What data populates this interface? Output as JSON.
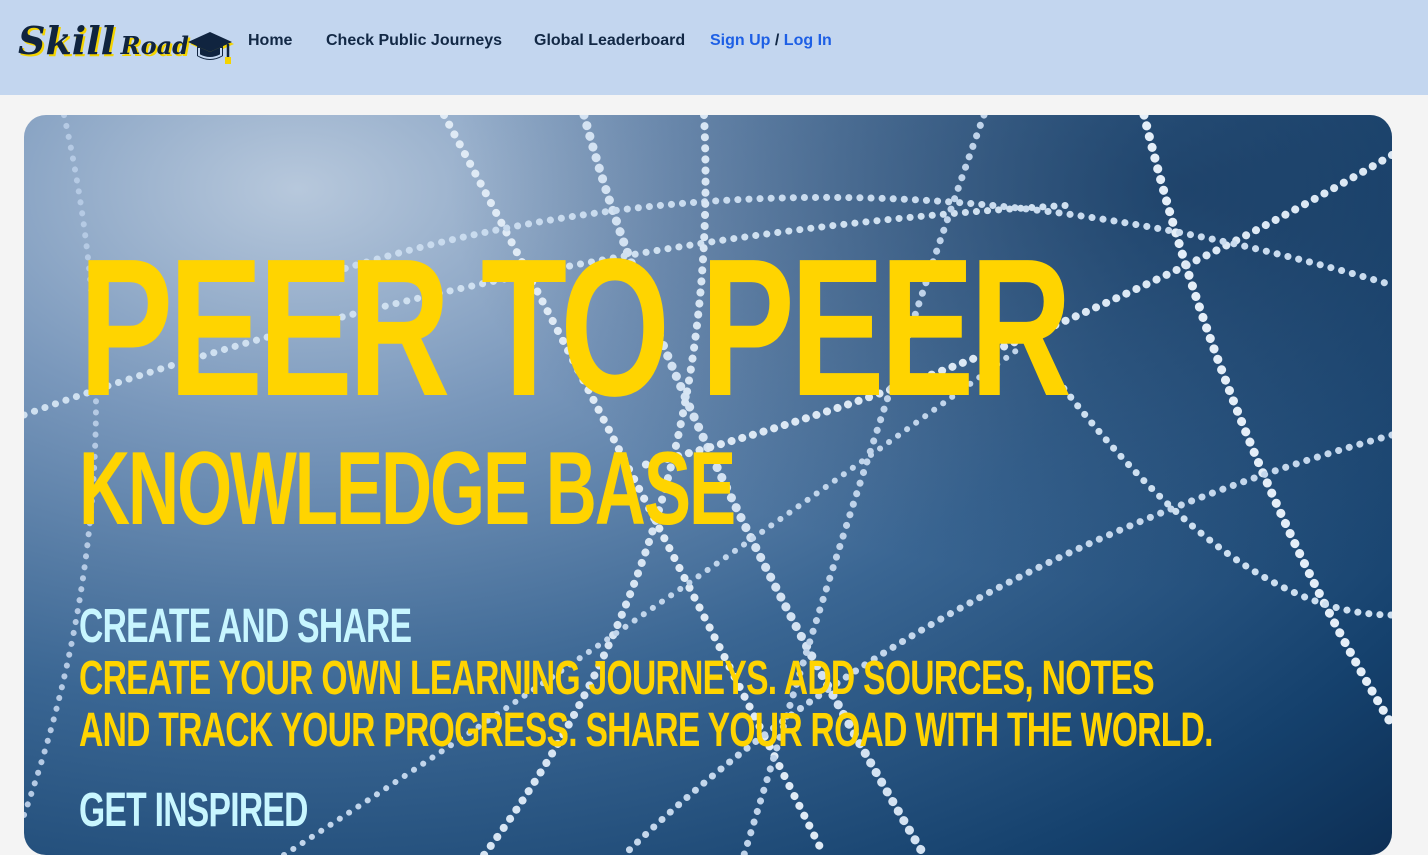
{
  "brand": {
    "name_first": "Skill",
    "name_second": "Road",
    "logo_icon": "graduation-cap-icon",
    "colors": {
      "ink": "#10243f",
      "accent": "#f4d400"
    }
  },
  "nav": {
    "home": "Home",
    "public_journeys": "Check Public Journeys",
    "leaderboard": "Global Leaderboard",
    "sign_up": "Sign Up",
    "separator": "/",
    "log_in": "Log In"
  },
  "hero": {
    "headline": "PEER TO PEER",
    "subheadline": "KNOWLEDGE BASE",
    "section1_title": "CREATE AND SHARE",
    "section1_line1": "CREATE YOUR OWN LEARNING JOURNEYS. ADD SOURCES, NOTES",
    "section1_line2": "AND TRACK YOUR PROGRESS. SHARE YOUR ROAD WITH THE WORLD.",
    "section2_title": "GET INSPIRED",
    "colors": {
      "headline": "#ffd400",
      "section_title": "#c8f6ff",
      "background": "#15416d"
    }
  }
}
